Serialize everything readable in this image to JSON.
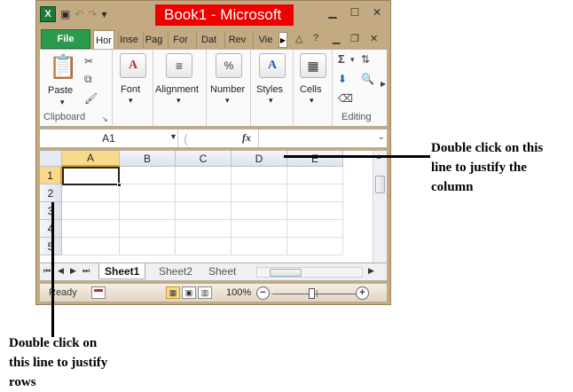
{
  "window": {
    "title": "Book1 - Microsoft",
    "app_logo": "X",
    "accent_colors": {
      "file_tab": "#2a9a4c",
      "title_highlight": "#ee0000",
      "selection": "#f9d98a"
    }
  },
  "ribbon_tabs": {
    "file": "File",
    "tabs": [
      "Hor",
      "Inse",
      "Pag",
      "For",
      "Dat",
      "Rev",
      "Vie"
    ]
  },
  "ribbon": {
    "clipboard": {
      "paste": "Paste",
      "group_label": "Clipboard"
    },
    "font": {
      "label": "Font"
    },
    "alignment": {
      "label": "Alignment"
    },
    "number": {
      "label": "Number",
      "icon_text": "%"
    },
    "styles": {
      "label": "Styles"
    },
    "cells": {
      "label": "Cells"
    },
    "editing": {
      "group_label": "Editing",
      "sum_symbol": "Σ"
    }
  },
  "formula_bar": {
    "name_box": "A1",
    "fx": "fx",
    "value": ""
  },
  "grid": {
    "columns": [
      "A",
      "B",
      "C",
      "D",
      "E"
    ],
    "rows": [
      "1",
      "2",
      "3",
      "4",
      "5"
    ],
    "selected_column": "A",
    "selected_row": "1"
  },
  "sheet_tabs": [
    "Sheet1",
    "Sheet2",
    "Sheet"
  ],
  "status": {
    "ready": "Ready",
    "zoom": "100%",
    "zoom_fraction": 0.5
  },
  "annotations": {
    "column_note": [
      "Double click on this",
      "line to justify the",
      "column"
    ],
    "row_note": [
      "Double click on",
      "this line to justify",
      "rows"
    ]
  }
}
